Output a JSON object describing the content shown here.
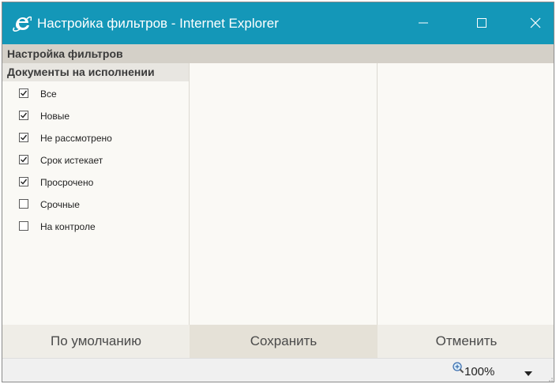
{
  "window": {
    "title": "Настройка фильтров - Internet Explorer"
  },
  "app": {
    "header_title": "Настройка фильтров"
  },
  "filters": {
    "section_title": "Документы на исполнении",
    "items": [
      {
        "label": "Все",
        "checked": true
      },
      {
        "label": "Новые",
        "checked": true
      },
      {
        "label": "Не рассмотрено",
        "checked": true
      },
      {
        "label": "Срок истекает",
        "checked": true
      },
      {
        "label": "Просрочено",
        "checked": true
      },
      {
        "label": "Срочные",
        "checked": false
      },
      {
        "label": "На контроле",
        "checked": false
      }
    ]
  },
  "footer": {
    "default_label": "По умолчанию",
    "save_label": "Сохранить",
    "cancel_label": "Отменить"
  },
  "statusbar": {
    "zoom": "100%"
  },
  "colors": {
    "titlebar": "#1497b8",
    "header_bg": "#d4d0c8",
    "panel_bg": "#faf9f5"
  },
  "icons": {
    "browser": "internet-explorer-icon",
    "minimize": "minimize-icon",
    "maximize": "maximize-icon",
    "close": "close-icon",
    "zoom": "zoom-in-icon",
    "dropdown": "dropdown-arrow-icon"
  }
}
